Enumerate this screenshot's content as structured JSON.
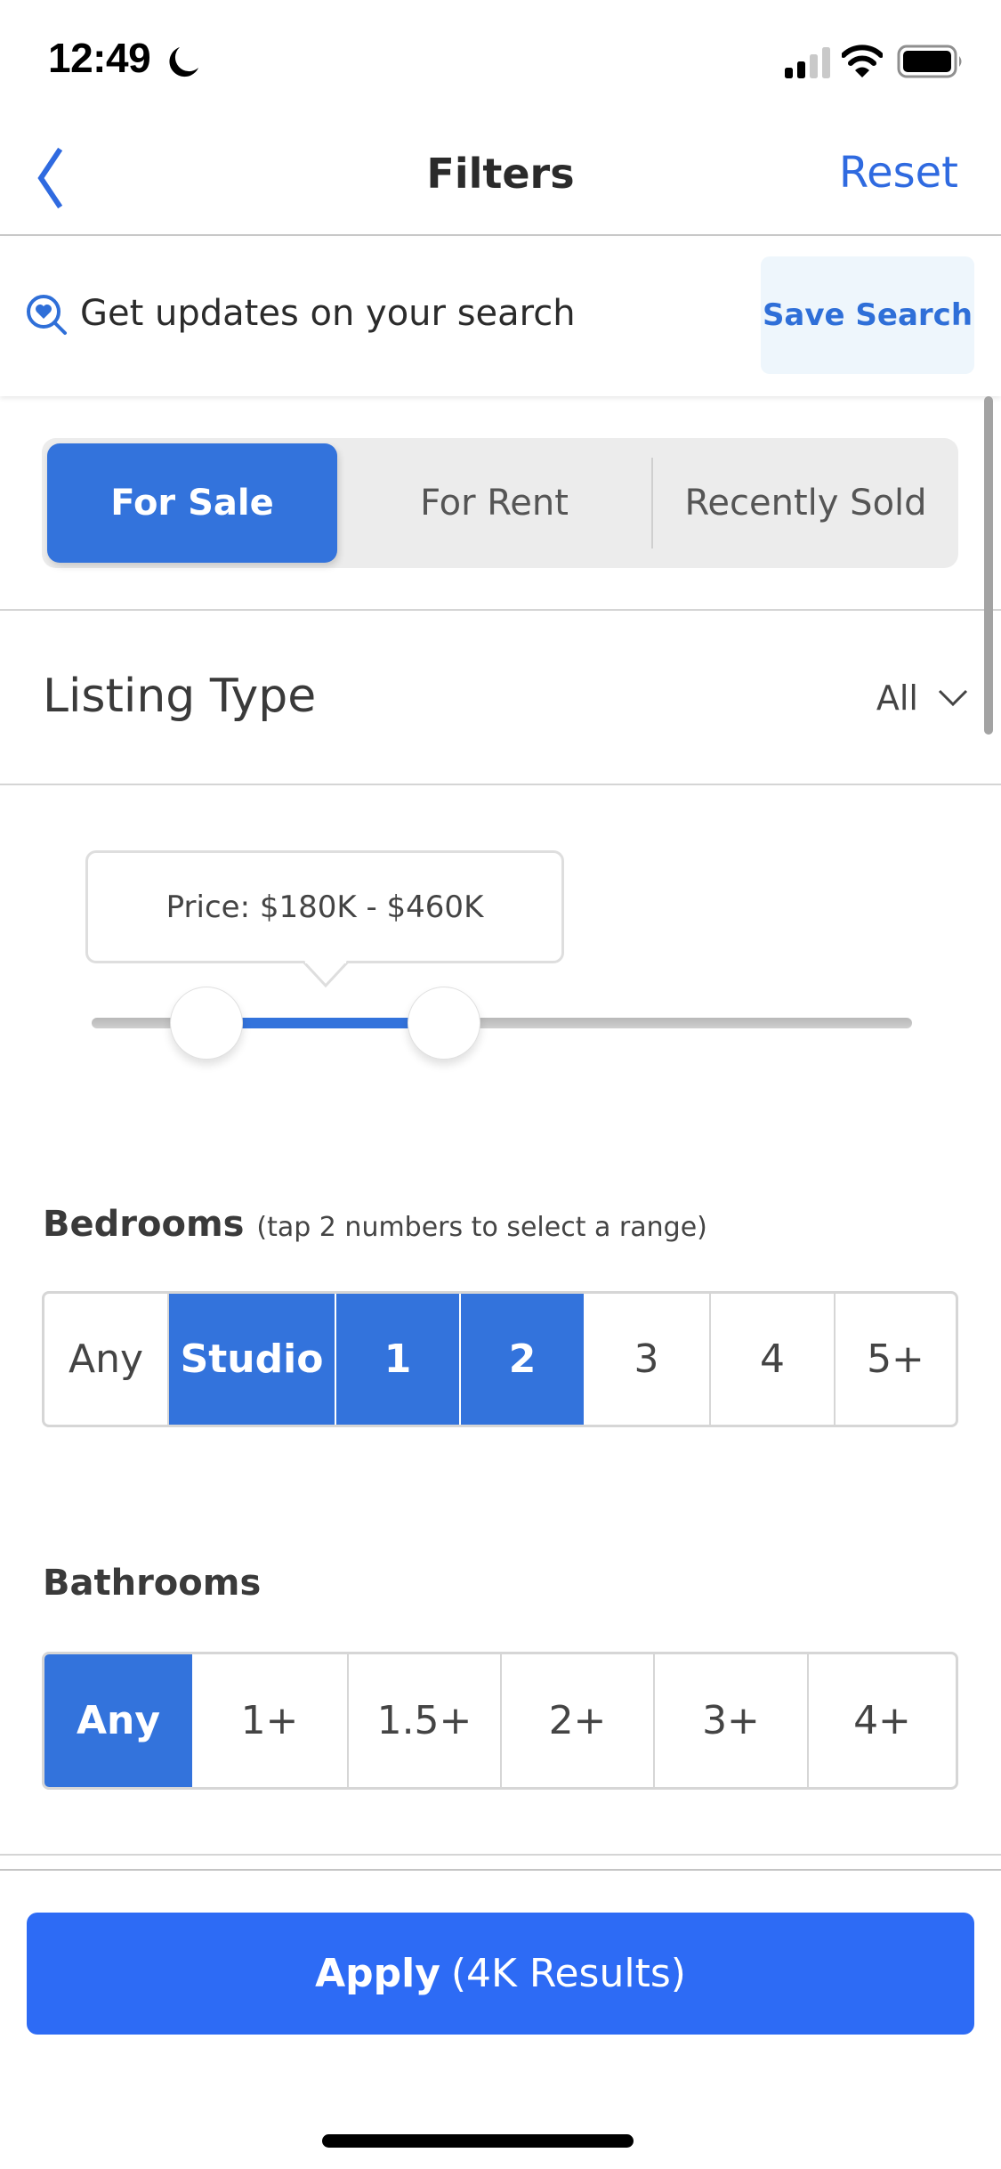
{
  "status_bar": {
    "time": "12:49",
    "focus_icon": "moon-icon",
    "signal_icon": "cellular-signal-icon",
    "signal_bars": 2,
    "signal_bars_max": 4,
    "wifi_icon": "wifi-icon",
    "battery_icon": "battery-icon"
  },
  "nav": {
    "back_icon": "chevron-left-icon",
    "title": "Filters",
    "reset_label": "Reset"
  },
  "save_search": {
    "icon": "heart-search-icon",
    "text": "Get updates on your search",
    "button_label": "Save Search"
  },
  "listing_status": {
    "options": [
      {
        "label": "For Sale",
        "selected": true
      },
      {
        "label": "For Rent",
        "selected": false
      },
      {
        "label": "Recently Sold",
        "selected": false
      }
    ]
  },
  "listing_type": {
    "label": "Listing Type",
    "value": "All",
    "icon": "chevron-down-icon"
  },
  "price": {
    "tooltip": "Price: $180K - $460K",
    "min_fraction": 0.14,
    "max_fraction": 0.43
  },
  "bedrooms": {
    "label": "Bedrooms",
    "hint": "(tap 2 numbers to select a range)",
    "options": [
      {
        "label": "Any",
        "selected": false
      },
      {
        "label": "Studio",
        "selected": true
      },
      {
        "label": "1",
        "selected": true
      },
      {
        "label": "2",
        "selected": true
      },
      {
        "label": "3",
        "selected": false
      },
      {
        "label": "4",
        "selected": false
      },
      {
        "label": "5+",
        "selected": false
      }
    ]
  },
  "bathrooms": {
    "label": "Bathrooms",
    "options": [
      {
        "label": "Any",
        "selected": true
      },
      {
        "label": "1+",
        "selected": false
      },
      {
        "label": "1.5+",
        "selected": false
      },
      {
        "label": "2+",
        "selected": false
      },
      {
        "label": "3+",
        "selected": false
      },
      {
        "label": "4+",
        "selected": false
      }
    ]
  },
  "apply": {
    "label": "Apply",
    "count": "(4K Results)"
  },
  "colors": {
    "accent": "#3373dc",
    "apply_button": "#2d6bf5",
    "link": "#2f6ae0",
    "save_search_bg": "#eef6fc"
  }
}
